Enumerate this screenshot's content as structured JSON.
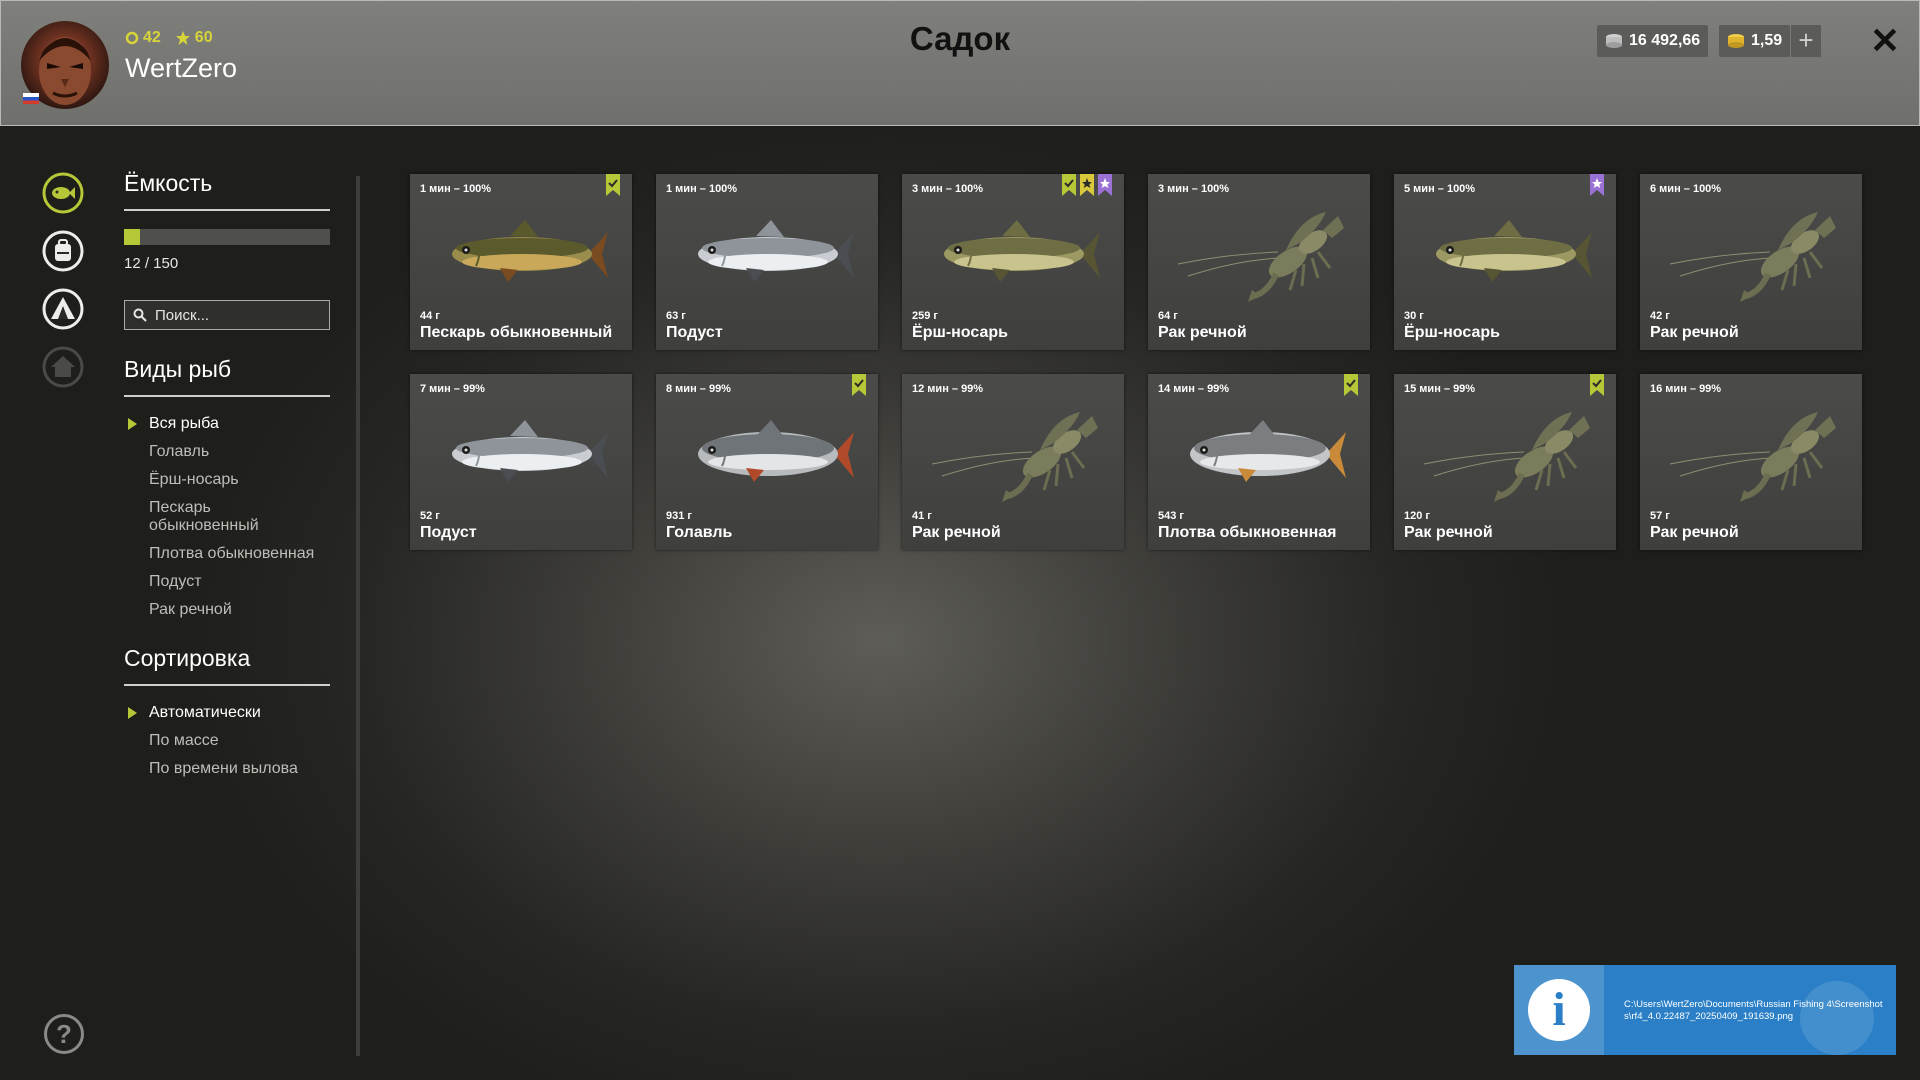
{
  "header": {
    "title": "Садок",
    "username": "WertZero",
    "level": "42",
    "rating": "60",
    "silver": "16 492,66",
    "gold": "1,59"
  },
  "sidebar": {
    "capacity_title": "Ёмкость",
    "capacity_text": "12 / 150",
    "capacity_fraction": 0.08,
    "search_placeholder": "Поиск...",
    "species_title": "Виды рыб",
    "species": [
      "Вся рыба",
      "Голавль",
      "Ёрш-носарь",
      "Пескарь обыкновенный",
      "Плотва обыкновенная",
      "Подуст",
      "Рак речной"
    ],
    "sort_title": "Сортировка",
    "sort_options": [
      "Автоматически",
      "По массе",
      "По времени вылова"
    ]
  },
  "catches": [
    {
      "time": "1 мин – 100%",
      "weight": "44 г",
      "name": "Пескарь обыкновенный",
      "art": "gudgeon",
      "badges": [
        "green"
      ]
    },
    {
      "time": "1 мин – 100%",
      "weight": "63 г",
      "name": "Подуст",
      "art": "silver",
      "badges": []
    },
    {
      "time": "3 мин – 100%",
      "weight": "259 г",
      "name": "Ёрш-носарь",
      "art": "ruffe",
      "badges": [
        "green",
        "yellow",
        "purple"
      ]
    },
    {
      "time": "3 мин – 100%",
      "weight": "64 г",
      "name": "Рак речной",
      "art": "crayfish",
      "badges": []
    },
    {
      "time": "5 мин – 100%",
      "weight": "30 г",
      "name": "Ёрш-носарь",
      "art": "ruffe",
      "badges": [
        "purple"
      ]
    },
    {
      "time": "6 мин – 100%",
      "weight": "42 г",
      "name": "Рак речной",
      "art": "crayfish",
      "badges": []
    },
    {
      "time": "7 мин – 99%",
      "weight": "52 г",
      "name": "Подуст",
      "art": "silver",
      "badges": []
    },
    {
      "time": "8 мин – 99%",
      "weight": "931 г",
      "name": "Голавль",
      "art": "chub",
      "badges": [
        "green"
      ]
    },
    {
      "time": "12 мин – 99%",
      "weight": "41 г",
      "name": "Рак речной",
      "art": "crayfish",
      "badges": []
    },
    {
      "time": "14 мин – 99%",
      "weight": "543 г",
      "name": "Плотва обыкновенная",
      "art": "roach",
      "badges": [
        "green"
      ]
    },
    {
      "time": "15 мин – 99%",
      "weight": "120 г",
      "name": "Рак речной",
      "art": "crayfish",
      "badges": [
        "green"
      ]
    },
    {
      "time": "16 мин – 99%",
      "weight": "57 г",
      "name": "Рак речной",
      "art": "crayfish",
      "badges": []
    }
  ],
  "notification": {
    "path": "C:\\Users\\WertZero\\Documents\\Russian Fishing 4\\Screenshots\\rf4_4.0.22487_20250409_191639.png"
  },
  "colors": {
    "accent": "#b6c738",
    "badge_green": "#b6c738",
    "badge_yellow": "#d9c93a",
    "badge_purple": "#9a72d6",
    "notification": "#2a7fc6"
  },
  "icons": {
    "rail": [
      "keepnet-fish-icon",
      "backpack-icon",
      "camp-tent-icon",
      "home-icon"
    ],
    "help": "question-icon"
  }
}
